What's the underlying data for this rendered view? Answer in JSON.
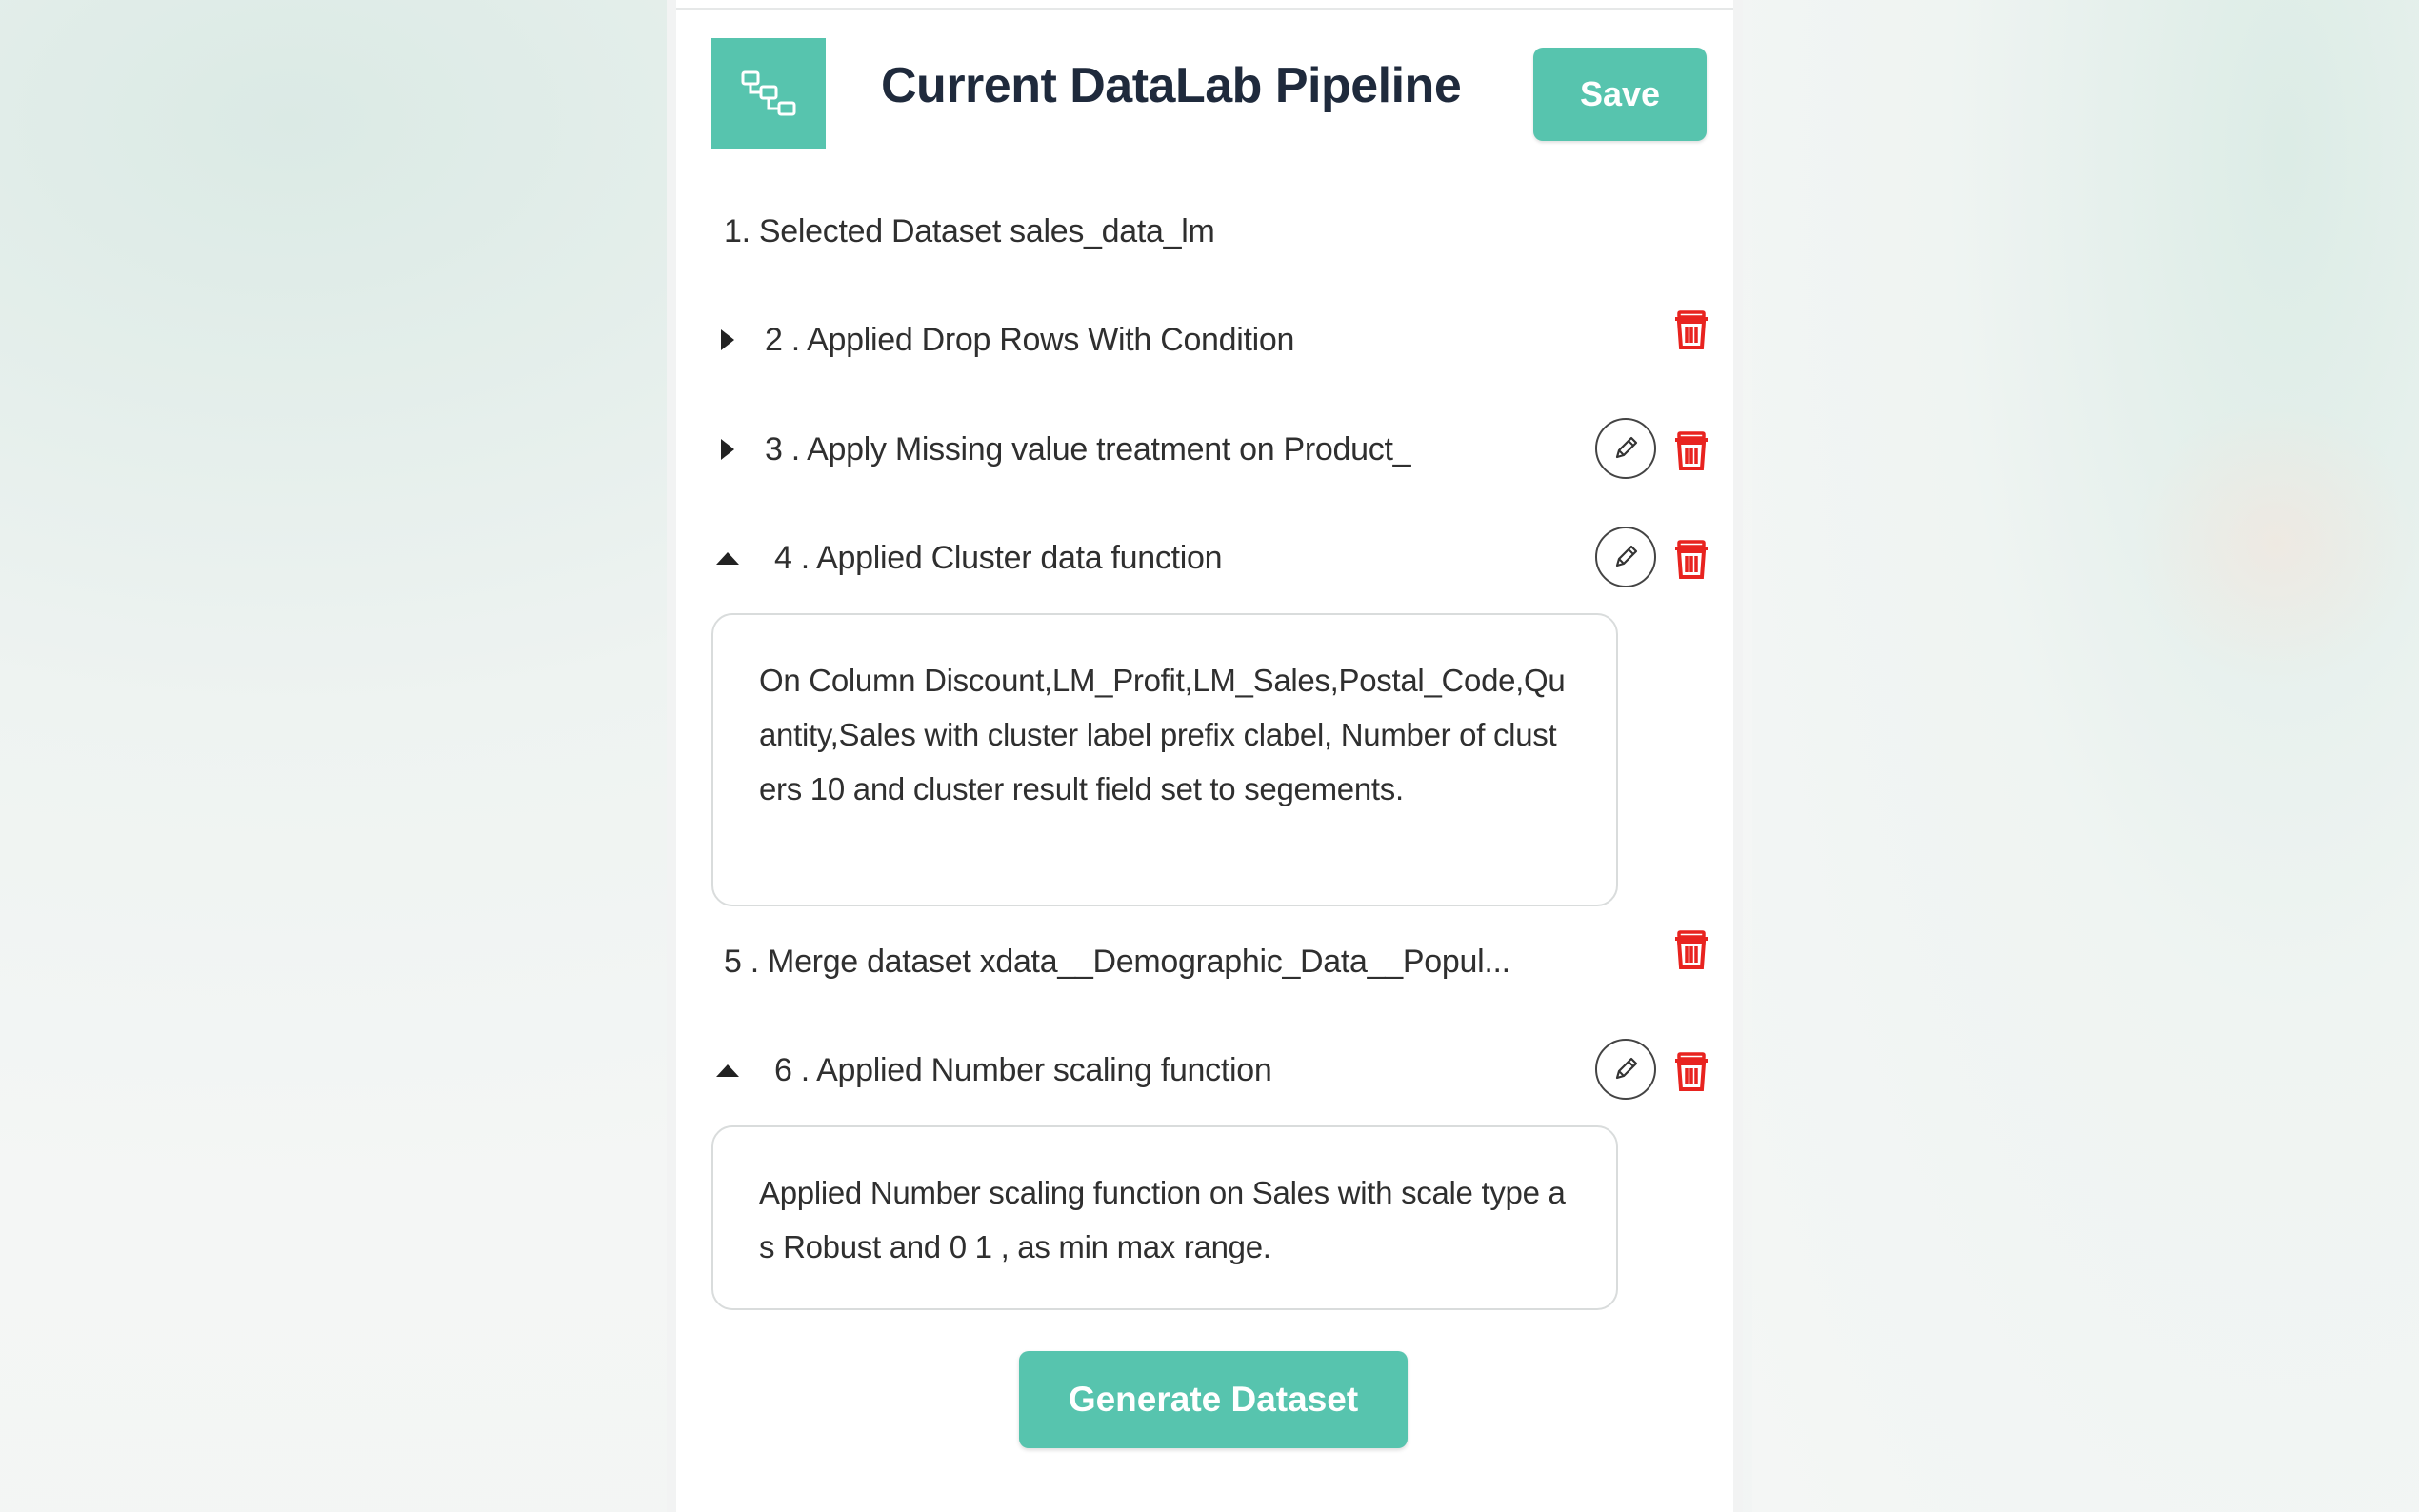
{
  "header": {
    "title": "Current DataLab Pipeline",
    "icon": "pipeline-flow-icon",
    "save_label": "Save"
  },
  "steps": [
    {
      "label": "1. Selected Dataset sales_data_lm",
      "expanded": null,
      "editable": false,
      "deletable": false
    },
    {
      "label": "2 . Applied Drop Rows With Condition",
      "expanded": false,
      "editable": false,
      "deletable": true
    },
    {
      "label": "3 . Apply Missing value treatment on Product_",
      "expanded": false,
      "editable": true,
      "deletable": true
    },
    {
      "label": "4 . Applied Cluster data function",
      "expanded": true,
      "editable": true,
      "deletable": true,
      "detail": "On Column Discount,LM_Profit,LM_Sales,Postal_Code,Quantity,Sales with cluster label prefix clabel, Number of clusters 10 and cluster result field set to segements."
    },
    {
      "label": "5 . Merge dataset xdata__Demographic_Data__Popul...",
      "expanded": null,
      "editable": false,
      "deletable": true
    },
    {
      "label": "6 . Applied Number scaling function",
      "expanded": true,
      "editable": true,
      "deletable": true,
      "detail": "Applied Number scaling function on Sales with scale type as Robust and 0 1 , as min max range."
    }
  ],
  "footer": {
    "generate_label": "Generate Dataset"
  },
  "colors": {
    "accent": "#57c4ae",
    "delete": "#e8231f",
    "text": "#2f2f2f",
    "title": "#1f2a3c"
  },
  "icons": {
    "collapsed_toggle": "caret-right-icon",
    "expanded_toggle": "caret-up-icon",
    "edit": "pencil-icon",
    "delete": "trash-icon"
  }
}
